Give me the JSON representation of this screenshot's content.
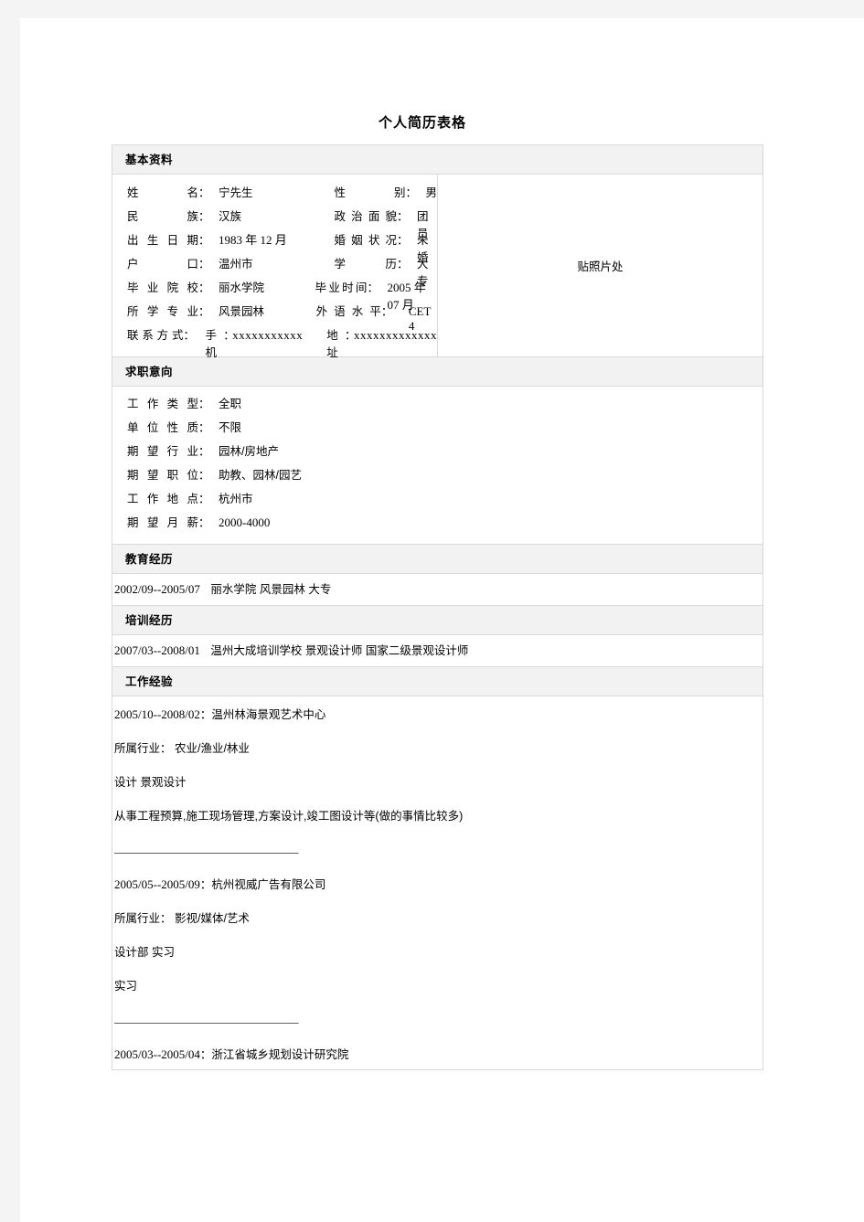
{
  "document": {
    "title": "个人简历表格"
  },
  "sections": {
    "basic": {
      "heading": "基本资料",
      "photo_placeholder": "贴照片处",
      "fields": [
        {
          "label": "姓 名",
          "value": "宁先生",
          "label2": "性 别",
          "value2": "男"
        },
        {
          "label": "民 族",
          "value": "汉族",
          "label2": "政治面貌",
          "value2": "团员"
        },
        {
          "label": "出生日期",
          "value": "1983 年 12 月",
          "label2": "婚姻状况",
          "value2": "未婚"
        },
        {
          "label": "户 口",
          "value": "温州市",
          "label2": "学 历",
          "value2": "大专"
        },
        {
          "label": "毕业院校",
          "value": "丽水学院",
          "label2": "毕业时间",
          "value2": "2005 年 07 月"
        },
        {
          "label": "所学专业",
          "value": "风景园林",
          "label2": "外语水平",
          "value2": "CET 4"
        }
      ],
      "contact": {
        "label": "联系方式",
        "phone_label": "手机",
        "phone_value": "xxxxxxxxxxx",
        "address_label": "地址",
        "address_value": "xxxxxxxxxxxxx"
      }
    },
    "intention": {
      "heading": "求职意向",
      "fields": [
        {
          "label": "工作类型",
          "value": "全职"
        },
        {
          "label": "单位性质",
          "value": "不限"
        },
        {
          "label": "期望行业",
          "value": "园林/房地产"
        },
        {
          "label": "期望职位",
          "value": "助教、园林/园艺"
        },
        {
          "label": "工作地点",
          "value": "杭州市"
        },
        {
          "label": "期望月薪",
          "value": "2000-4000"
        }
      ]
    },
    "education": {
      "heading": "教育经历",
      "entry_date": "2002/09--2005/07",
      "entry_text": "丽水学院 风景园林 大专"
    },
    "training": {
      "heading": "培训经历",
      "entry_date": "2007/03--2008/01",
      "entry_text": "温州大成培训学校 景观设计师 国家二级景观设计师"
    },
    "work": {
      "heading": "工作经验",
      "separator": "_______________________________",
      "entries": [
        {
          "date": "2005/10--2008/02",
          "company": "：温州林海景观艺术中心",
          "industry": "所属行业： 农业/渔业/林业",
          "department": "设计 景观设计",
          "description": "从事工程预算,施工现场管理,方案设计,竣工图设计等(做的事情比较多)"
        },
        {
          "date": "2005/05--2005/09",
          "company": "：杭州视威广告有限公司",
          "industry": "所属行业： 影视/媒体/艺术",
          "department": "设计部 实习",
          "description": "实习"
        },
        {
          "date": "2005/03--2005/04",
          "company": "：浙江省城乡规划设计研究院",
          "industry": "",
          "department": "",
          "description": ""
        }
      ]
    }
  }
}
